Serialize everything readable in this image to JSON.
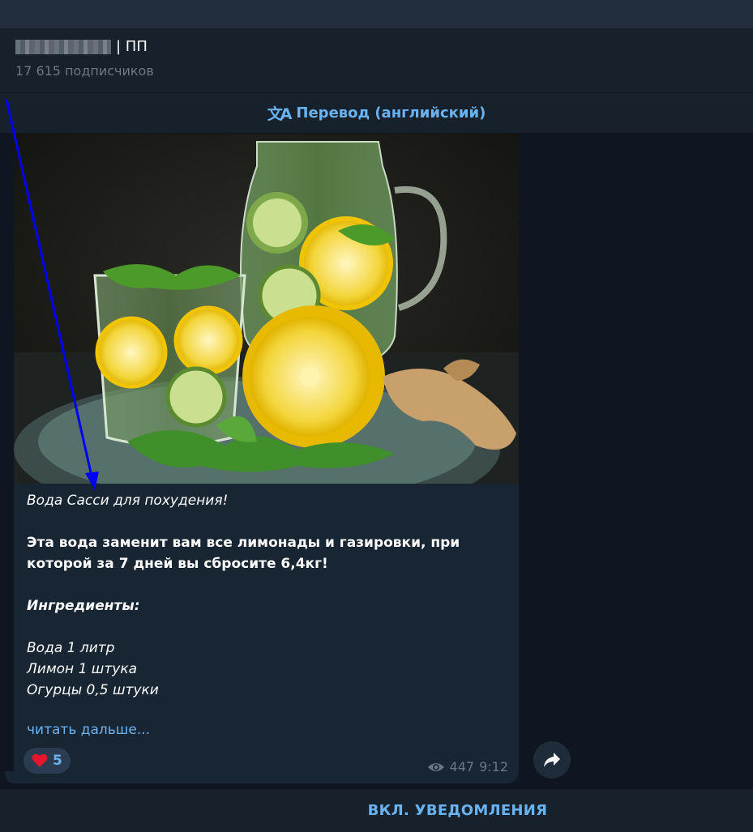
{
  "channel": {
    "name_suffix": "| ПП",
    "subscribers": "17 615 подписчиков"
  },
  "translate": {
    "icon": "translate-icon",
    "label": "Перевод (английский)"
  },
  "post": {
    "caption_title": "Вода Сасси для похудения!",
    "caption_lines": [
      "Эта вода заменит вам все лимонады и газировки, при",
      "которой за 7 дней вы сбросите 6,4кг!"
    ],
    "ingredients_header": "Ингредиенты:",
    "ingredients": [
      "Вода 1 литр",
      "Лимон 1 штука",
      "Огурцы 0,5 штуки"
    ],
    "read_more": "читать дальше...",
    "reaction": {
      "icon": "heart-icon",
      "count": "5"
    },
    "views": "447",
    "time": "9:12"
  },
  "bottom": {
    "notify_label": "ВКЛ. УВЕДОМЛЕНИЯ"
  },
  "colors": {
    "background": "#0e1621",
    "panel": "#17212b",
    "bubble": "#182533",
    "accent": "#6ab3f3",
    "muted": "#6c7883",
    "annotation_arrow": "#0000ff"
  }
}
